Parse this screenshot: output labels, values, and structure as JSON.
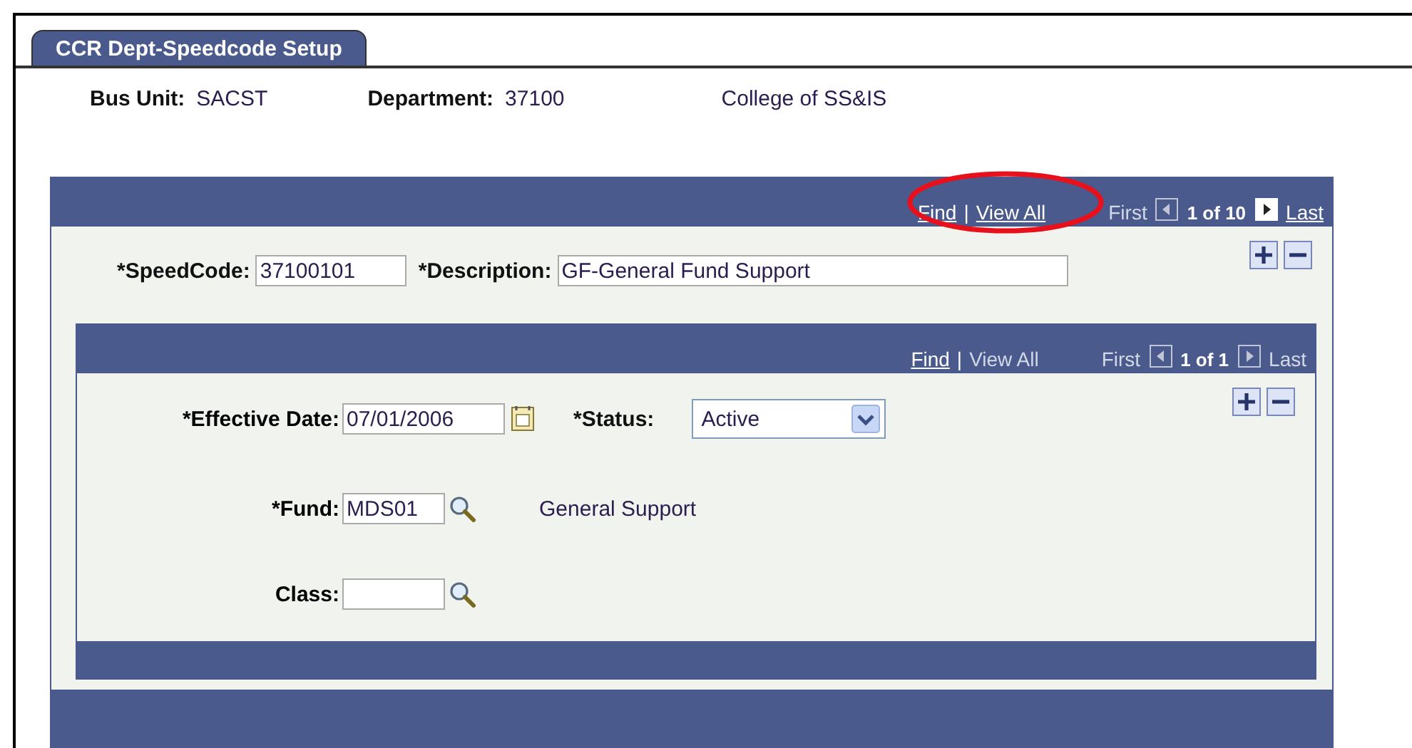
{
  "tab": {
    "label": "CCR Dept-Speedcode Setup",
    "selected": true
  },
  "header": {
    "fields": [
      {
        "label": "Bus Unit:",
        "value": "SACST"
      },
      {
        "label": "Department:",
        "value": "37100"
      }
    ],
    "department_description": "College of SS&IS"
  },
  "speedcode_panel": {
    "nav": {
      "circled": true,
      "find": {
        "label": "Find",
        "disabled": false
      },
      "separator": "|",
      "view_all": {
        "label": "View All",
        "disabled": false
      },
      "first": {
        "label": "First",
        "disabled": true
      },
      "prev_disabled": true,
      "count": "1 of 10",
      "next_disabled": false,
      "last": {
        "label": "Last",
        "disabled": false
      }
    },
    "speedcode": {
      "label": "*SpeedCode:",
      "value": "37100101"
    },
    "description": {
      "label": "*Description:",
      "value": "GF-General Fund Support"
    },
    "effdt_panel": {
      "nav": {
        "find": {
          "label": "Find",
          "disabled": false
        },
        "separator": "|",
        "view_all": {
          "label": "View All",
          "disabled": true
        },
        "first": {
          "label": "First",
          "disabled": true
        },
        "prev_disabled": true,
        "count": "1 of 1",
        "next_disabled": true,
        "last": {
          "label": "Last",
          "disabled": true
        }
      },
      "effective_date": {
        "label": "*Effective Date:",
        "value": "07/01/2006"
      },
      "status": {
        "label": "*Status:",
        "value": "Active"
      },
      "fund": {
        "label": "*Fund:",
        "value": "MDS01",
        "description": "General Support"
      },
      "class": {
        "label": "Class:"
      }
    }
  }
}
